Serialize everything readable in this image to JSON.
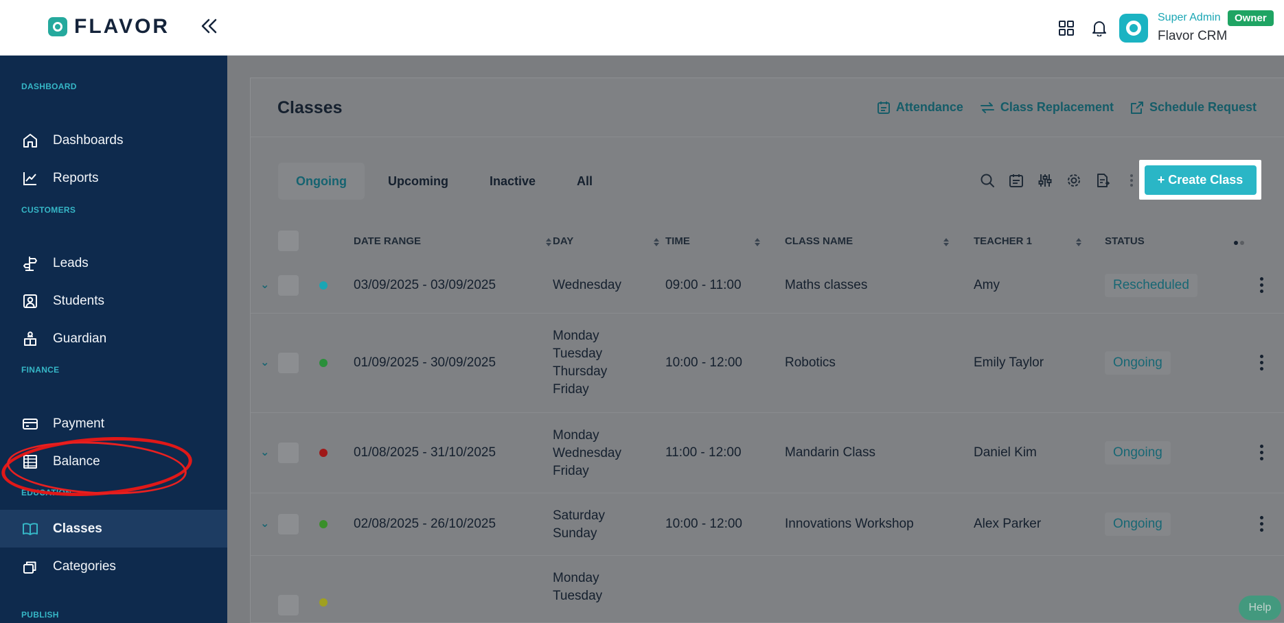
{
  "brand": {
    "logo_text": "FLAVOR"
  },
  "header": {
    "user_role": "Super Admin",
    "owner_badge": "Owner",
    "org_name": "Flavor CRM"
  },
  "sidebar": {
    "sections": {
      "dashboard": "DASHBOARD",
      "customers": "CUSTOMERS",
      "finance": "FINANCE",
      "education": "EDUCATION",
      "publish": "PUBLISH"
    },
    "items": {
      "dashboards": "Dashboards",
      "reports": "Reports",
      "leads": "Leads",
      "students": "Students",
      "guardian": "Guardian",
      "payment": "Payment",
      "balance": "Balance",
      "classes": "Classes",
      "categories": "Categories"
    },
    "active_item": "Classes"
  },
  "page": {
    "title": "Classes",
    "links": {
      "attendance": "Attendance",
      "class_replacement": "Class Replacement",
      "schedule_request": "Schedule Request"
    },
    "tabs": [
      "Ongoing",
      "Upcoming",
      "Inactive",
      "All"
    ],
    "active_tab": "Ongoing",
    "create_button": "+ Create Class"
  },
  "table": {
    "columns": [
      "DATE RANGE",
      "DAY",
      "TIME",
      "CLASS NAME",
      "TEACHER 1",
      "STATUS"
    ],
    "rows": [
      {
        "date_range": "03/09/2025 - 03/09/2025",
        "day": "Wednesday",
        "time": "09:00 - 11:00",
        "class_name": "Maths classes",
        "teacher": "Amy",
        "status": "Rescheduled",
        "dot_color": "#1aa6b4"
      },
      {
        "date_range": "01/09/2025 - 30/09/2025",
        "day": "Monday\nTuesday\nThursday\nFriday",
        "time": "10:00 - 12:00",
        "class_name": "Robotics",
        "teacher": "Emily Taylor",
        "status": "Ongoing",
        "dot_color": "#2a8f3a"
      },
      {
        "date_range": "01/08/2025 - 31/10/2025",
        "day": "Monday\nWednesday\nFriday",
        "time": "11:00 - 12:00",
        "class_name": "Mandarin Class",
        "teacher": "Daniel Kim",
        "status": "Ongoing",
        "dot_color": "#a01818"
      },
      {
        "date_range": "02/08/2025 - 26/10/2025",
        "day": "Saturday\nSunday",
        "time": "10:00 - 12:00",
        "class_name": "Innovations Workshop",
        "teacher": "Alex Parker",
        "status": "Ongoing",
        "dot_color": "#3a8f2a"
      },
      {
        "date_range": "",
        "day": "Monday\nTuesday",
        "time": "",
        "class_name": "",
        "teacher": "",
        "status": "",
        "dot_color": "#a0a020"
      }
    ]
  },
  "help_label": "Help",
  "colors": {
    "sidebar_bg": "#0e2a4d",
    "accent": "#2ab6c6",
    "owner_badge": "#1fa463"
  }
}
